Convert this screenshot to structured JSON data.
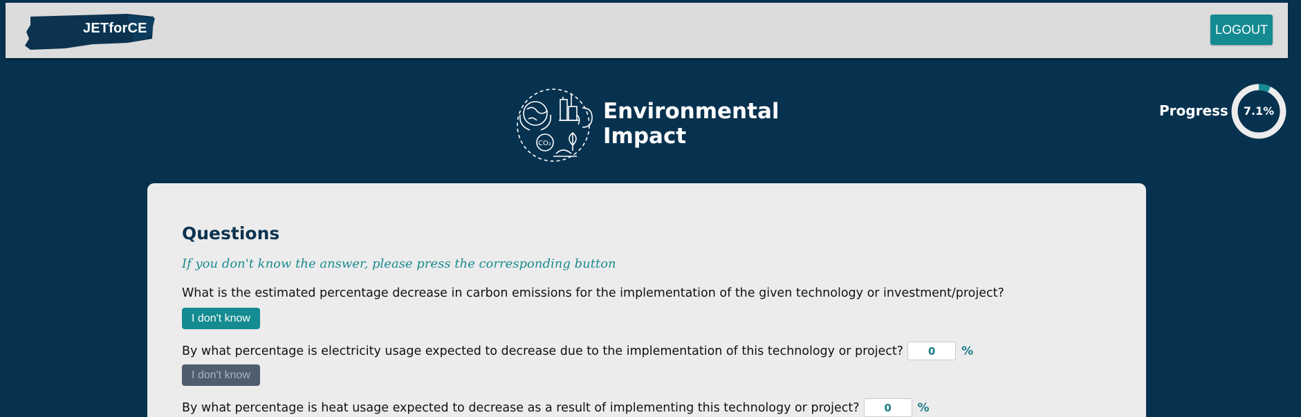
{
  "header": {
    "brand": "JETforCE",
    "logout_label": "LOGOUT"
  },
  "section": {
    "icon": "environment-icon",
    "title_line1": "Environmental",
    "title_line2": "Impact"
  },
  "progress": {
    "label": "Progress",
    "value_text": "7.1%",
    "fraction": 0.071
  },
  "questions": {
    "heading": "Questions",
    "hint": "If you don't know the answer, please press the corresponding button",
    "items": [
      {
        "text": "What is the estimated percentage decrease in carbon emissions for the implementation of the given technology or investment/project?",
        "button": "I don't know",
        "button_state": "active"
      },
      {
        "text": "By what percentage is electricity usage expected to decrease due to the implementation of this technology or project?",
        "value": "0",
        "unit": "%",
        "button": "I don't know",
        "button_state": "disabled"
      },
      {
        "text": "By what percentage is heat usage expected to decrease as a result of implementing this technology or project?",
        "value": "0",
        "unit": "%"
      }
    ]
  },
  "colors": {
    "background": "#07324f",
    "accent": "#138b91",
    "card": "#ececec"
  }
}
